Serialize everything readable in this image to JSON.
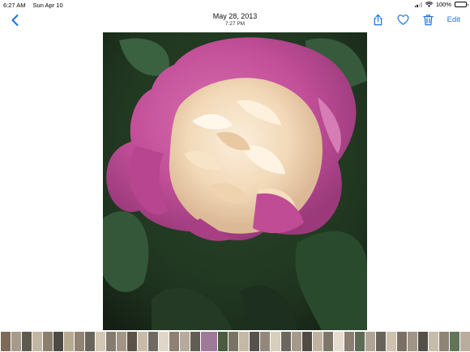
{
  "status_bar": {
    "time": "6:27 AM",
    "date": "Sun Apr 10",
    "battery": "100%"
  },
  "nav": {
    "date": "May 28, 2013",
    "time": "7:27 PM",
    "edit_label": "Edit"
  },
  "colors": {
    "accent": "#1a73e8",
    "petal_pink": "#c5519b",
    "petal_center": "#f1dcbc",
    "foliage": "#2d4a2c"
  },
  "icons": [
    "back-chevron-icon",
    "share-icon",
    "heart-icon",
    "trash-icon",
    "wifi-icon",
    "battery-icon"
  ],
  "filmstrip": {
    "thumb_colors": [
      "#7d6a58",
      "#a69b8b",
      "#5f5a50",
      "#c2b6a4",
      "#8b7e6d",
      "#4d4943",
      "#b8a993",
      "#928373",
      "#6a655c",
      "#d2c6b4",
      "#857b70",
      "#a39585",
      "#5c5247",
      "#c9bba9",
      "#706b62",
      "#e0d6c8",
      "#8e8174",
      "#b5aa9c",
      "#615c54",
      "#9e7a98",
      "#4a5b40",
      "#7a7466",
      "#c4b8a6",
      "#56524b",
      "#93887b",
      "#d8cebe",
      "#6c675e",
      "#a7998a",
      "#4f4a44",
      "#bfb29f",
      "#7e7769",
      "#e4dccf",
      "#8a7f72",
      "#5e6a55",
      "#b0a595",
      "#69645b",
      "#cdc2b0",
      "#7b7063",
      "#a09586",
      "#545049",
      "#c7bcaa",
      "#8f8476",
      "#617559",
      "#b9ae9e",
      "#736e64",
      "#dbd2c3",
      "#877c6f",
      "#9fc2e0",
      "#5a564f",
      "#c0b5a3"
    ],
    "selected_index": 19
  }
}
